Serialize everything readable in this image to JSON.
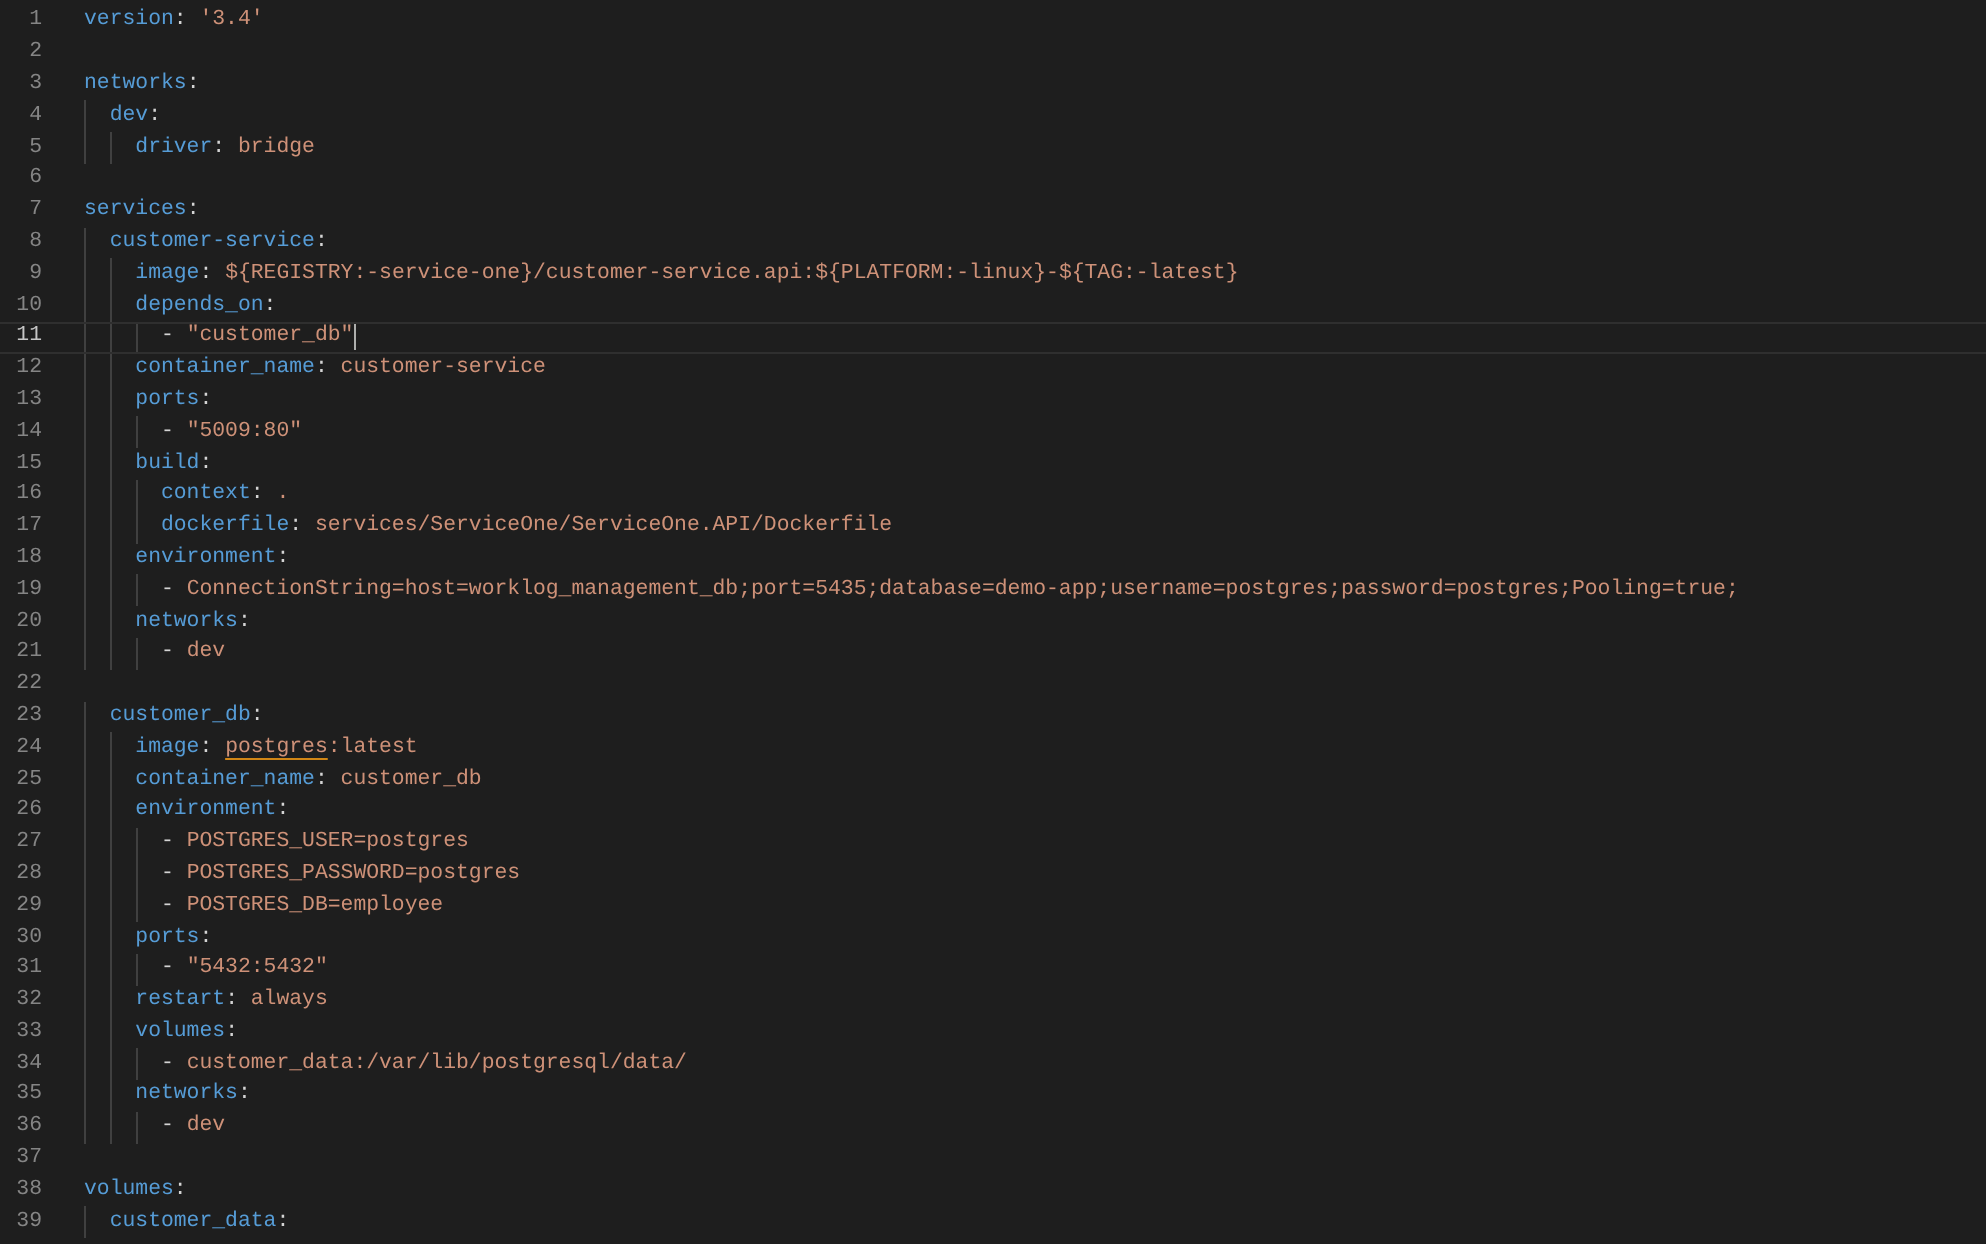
{
  "editor": {
    "lines": [
      {
        "number": "1",
        "current": false,
        "segments": [
          {
            "kind": "key",
            "text": "version"
          },
          {
            "kind": "punct",
            "text": ": "
          },
          {
            "kind": "value",
            "text": "'3.4'"
          }
        ]
      },
      {
        "number": "2",
        "current": false
      },
      {
        "number": "3",
        "current": false,
        "segments": [
          {
            "kind": "key",
            "text": "networks"
          },
          {
            "kind": "punct",
            "text": ":"
          }
        ]
      },
      {
        "number": "4",
        "current": false,
        "segments": [
          {
            "kind": "key",
            "text": "  dev"
          },
          {
            "kind": "punct",
            "text": ":"
          }
        ]
      },
      {
        "number": "5",
        "current": false,
        "segments": [
          {
            "kind": "key",
            "text": "    driver"
          },
          {
            "kind": "punct",
            "text": ": "
          },
          {
            "kind": "value",
            "text": "bridge"
          }
        ]
      },
      {
        "number": "6",
        "current": false
      },
      {
        "number": "7",
        "current": false,
        "segments": [
          {
            "kind": "key",
            "text": "services"
          },
          {
            "kind": "punct",
            "text": ":"
          }
        ]
      },
      {
        "number": "8",
        "current": false,
        "segments": [
          {
            "kind": "key",
            "text": "  customer-service"
          },
          {
            "kind": "punct",
            "text": ":"
          }
        ]
      },
      {
        "number": "9",
        "current": false,
        "segments": [
          {
            "kind": "key",
            "text": "    image"
          },
          {
            "kind": "punct",
            "text": ": "
          },
          {
            "kind": "value",
            "text": "${REGISTRY:-service-one}/customer-service.api:${PLATFORM:-linux}-${TAG:-latest}"
          }
        ]
      },
      {
        "number": "10",
        "current": false,
        "segments": [
          {
            "kind": "key",
            "text": "    depends_on"
          },
          {
            "kind": "punct",
            "text": ":"
          }
        ]
      },
      {
        "number": "11",
        "current": true,
        "segments": [
          {
            "kind": "punct",
            "text": "      - "
          },
          {
            "kind": "value",
            "text": "\"customer_db\""
          }
        ]
      },
      {
        "number": "12",
        "current": false,
        "segments": [
          {
            "kind": "key",
            "text": "    container_name"
          },
          {
            "kind": "punct",
            "text": ": "
          },
          {
            "kind": "value",
            "text": "customer-service"
          }
        ]
      },
      {
        "number": "13",
        "current": false,
        "segments": [
          {
            "kind": "key",
            "text": "    ports"
          },
          {
            "kind": "punct",
            "text": ":"
          }
        ]
      },
      {
        "number": "14",
        "current": false,
        "segments": [
          {
            "kind": "punct",
            "text": "      - "
          },
          {
            "kind": "value",
            "text": "\"5009:80\""
          }
        ]
      },
      {
        "number": "15",
        "current": false,
        "segments": [
          {
            "kind": "key",
            "text": "    build"
          },
          {
            "kind": "punct",
            "text": ":"
          }
        ]
      },
      {
        "number": "16",
        "current": false,
        "segments": [
          {
            "kind": "key",
            "text": "      context"
          },
          {
            "kind": "punct",
            "text": ": "
          },
          {
            "kind": "value",
            "text": "."
          }
        ]
      },
      {
        "number": "17",
        "current": false,
        "segments": [
          {
            "kind": "key",
            "text": "      dockerfile"
          },
          {
            "kind": "punct",
            "text": ": "
          },
          {
            "kind": "value",
            "text": "services/ServiceOne/ServiceOne.API/Dockerfile"
          }
        ]
      },
      {
        "number": "18",
        "current": false,
        "segments": [
          {
            "kind": "key",
            "text": "    environment"
          },
          {
            "kind": "punct",
            "text": ":"
          }
        ]
      },
      {
        "number": "19",
        "current": false,
        "segments": [
          {
            "kind": "punct",
            "text": "      - "
          },
          {
            "kind": "value",
            "text": "ConnectionString=host=worklog_management_db;port=5435;database=demo-app;username=postgres;password=postgres;Pooling=true;"
          }
        ]
      },
      {
        "number": "20",
        "current": false,
        "segments": [
          {
            "kind": "key",
            "text": "    networks"
          },
          {
            "kind": "punct",
            "text": ":"
          }
        ]
      },
      {
        "number": "21",
        "current": false,
        "segments": [
          {
            "kind": "punct",
            "text": "      - "
          },
          {
            "kind": "value",
            "text": "dev"
          }
        ]
      },
      {
        "number": "22",
        "current": false
      },
      {
        "number": "23",
        "current": false,
        "segments": [
          {
            "kind": "key",
            "text": "  customer_db"
          },
          {
            "kind": "punct",
            "text": ":"
          }
        ]
      },
      {
        "number": "24",
        "current": false,
        "segments": [
          {
            "kind": "key",
            "text": "    image"
          },
          {
            "kind": "punct",
            "text": ": "
          },
          {
            "kind": "flagged",
            "text": "postgres"
          },
          {
            "kind": "value",
            "text": ":latest"
          }
        ]
      },
      {
        "number": "25",
        "current": false,
        "segments": [
          {
            "kind": "key",
            "text": "    container_name"
          },
          {
            "kind": "punct",
            "text": ": "
          },
          {
            "kind": "value",
            "text": "customer_db"
          }
        ]
      },
      {
        "number": "26",
        "current": false,
        "segments": [
          {
            "kind": "key",
            "text": "    environment"
          },
          {
            "kind": "punct",
            "text": ":"
          }
        ]
      },
      {
        "number": "27",
        "current": false,
        "segments": [
          {
            "kind": "punct",
            "text": "      - "
          },
          {
            "kind": "value",
            "text": "POSTGRES_USER=postgres"
          }
        ]
      },
      {
        "number": "28",
        "current": false,
        "segments": [
          {
            "kind": "punct",
            "text": "      - "
          },
          {
            "kind": "value",
            "text": "POSTGRES_PASSWORD=postgres"
          }
        ]
      },
      {
        "number": "29",
        "current": false,
        "segments": [
          {
            "kind": "punct",
            "text": "      - "
          },
          {
            "kind": "value",
            "text": "POSTGRES_DB=employee"
          }
        ]
      },
      {
        "number": "30",
        "current": false,
        "segments": [
          {
            "kind": "key",
            "text": "    ports"
          },
          {
            "kind": "punct",
            "text": ":"
          }
        ]
      },
      {
        "number": "31",
        "current": false,
        "segments": [
          {
            "kind": "punct",
            "text": "      - "
          },
          {
            "kind": "value",
            "text": "\"5432:5432\""
          }
        ]
      },
      {
        "number": "32",
        "current": false,
        "segments": [
          {
            "kind": "key",
            "text": "    restart"
          },
          {
            "kind": "punct",
            "text": ": "
          },
          {
            "kind": "value",
            "text": "always"
          }
        ]
      },
      {
        "number": "33",
        "current": false,
        "segments": [
          {
            "kind": "key",
            "text": "    volumes"
          },
          {
            "kind": "punct",
            "text": ":"
          }
        ]
      },
      {
        "number": "34",
        "current": false,
        "segments": [
          {
            "kind": "punct",
            "text": "      - "
          },
          {
            "kind": "value",
            "text": "customer_data:/var/lib/postgresql/data/"
          }
        ]
      },
      {
        "number": "35",
        "current": false,
        "segments": [
          {
            "kind": "key",
            "text": "    networks"
          },
          {
            "kind": "punct",
            "text": ":"
          }
        ]
      },
      {
        "number": "36",
        "current": false,
        "segments": [
          {
            "kind": "punct",
            "text": "      - "
          },
          {
            "kind": "value",
            "text": "dev"
          }
        ]
      },
      {
        "number": "37",
        "current": false
      },
      {
        "number": "38",
        "current": false,
        "segments": [
          {
            "kind": "key",
            "text": "volumes"
          },
          {
            "kind": "punct",
            "text": ":"
          }
        ]
      },
      {
        "number": "39",
        "current": false,
        "segments": [
          {
            "kind": "key",
            "text": "  customer_data"
          },
          {
            "kind": "punct",
            "text": ":"
          }
        ]
      }
    ]
  }
}
